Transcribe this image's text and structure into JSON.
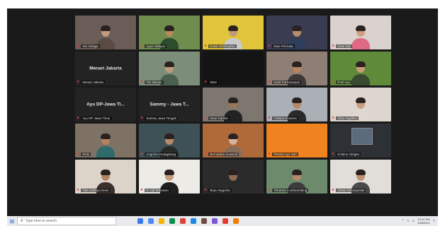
{
  "gallery": {
    "tiles": [
      {
        "label": "Vivi Sinaga",
        "bg": "#6a5d58",
        "kind": "video",
        "skin": "#c59a7c",
        "shirt": "#5a4a44"
      },
      {
        "label": "Agus Hidayat",
        "bg": "#6f8d4d",
        "kind": "video",
        "skin": "#b7885e",
        "shirt": "#2b4c2d",
        "active": true
      },
      {
        "label": "Erwin Christopher",
        "bg": "#e0c43a",
        "kind": "video",
        "skin": "#c59a7c",
        "shirt": "#c9c9c9"
      },
      {
        "label": "Dian Permata",
        "bg": "#3a3c52",
        "kind": "video",
        "skin": "#b58d6d",
        "shirt": "#2d3d5a"
      },
      {
        "label": "Dewi Sari",
        "bg": "#d9d2ce",
        "kind": "video",
        "skin": "#d0a080",
        "shirt": "#e06a86"
      },
      {
        "label": "Menari Jakarta",
        "bg": "#232323",
        "kind": "name",
        "center": "Menari Jakarta"
      },
      {
        "label": "Tim Menari",
        "bg": "#7c8e7a",
        "kind": "video",
        "skin": "#c29a7c",
        "shirt": "#4a6050"
      },
      {
        "label": "Wiwi",
        "bg": "#141414",
        "kind": "dark"
      },
      {
        "label": "Santi Purnamasari",
        "bg": "#8f7e74",
        "kind": "video",
        "skin": "#b8865e",
        "shirt": "#3e3a38"
      },
      {
        "label": "Putri Ayu",
        "bg": "#5e8a3a",
        "kind": "video",
        "skin": "#c99a78",
        "shirt": "#3a4a2e"
      },
      {
        "label": "Ayu DP Jawa Timur",
        "bg": "#232323",
        "kind": "name",
        "center": "Ayu DP-Jawa Ti..."
      },
      {
        "label": "Sammy Jawa Tengah",
        "bg": "#232323",
        "kind": "name",
        "center": "Sammy - Jawa T..."
      },
      {
        "label": "Irene Kartika",
        "bg": "#7d776f",
        "kind": "video",
        "skin": "#9d7658",
        "shirt": "#222222"
      },
      {
        "label": "Yuliana Kusuma",
        "bg": "#aab0b6",
        "kind": "video",
        "skin": "#b58866",
        "shirt": "#2a2a2a"
      },
      {
        "label": "Nina Angelina",
        "bg": "#dcd6cf",
        "kind": "video",
        "skin": "#c99e7d",
        "shirt": "#e0d8cf"
      },
      {
        "label": "Rizki",
        "bg": "#7e7265",
        "kind": "video",
        "skin": "#b4845e",
        "shirt": "#2f6b6a"
      },
      {
        "label": "Angelina Hutagalung",
        "bg": "#3e5157",
        "kind": "video",
        "skin": "#b98a66",
        "shirt": "#2a2a2a"
      },
      {
        "label": "Bernadeta Suwandi",
        "bg": "#b06a3a",
        "kind": "video",
        "skin": "#d7b09a",
        "shirt": "#8a6c5a"
      },
      {
        "label": "Teresia Ayu Sari",
        "bg": "#f0831f",
        "kind": "orange"
      },
      {
        "label": "Kristina Tarigan",
        "bg": "#2d3135",
        "kind": "screen"
      },
      {
        "label": "Tata Sulistya Dewi",
        "bg": "#dcd3c9",
        "kind": "video",
        "skin": "#b08560",
        "shirt": "#3a2f2c"
      },
      {
        "label": "R. Adi Setiawan",
        "bg": "#ecebe6",
        "kind": "video",
        "skin": "#c49b7b",
        "shirt": "#1f1f1f"
      },
      {
        "label": "Bayu Nugroho",
        "bg": "#2b2b2b",
        "kind": "video",
        "skin": "#8f6b52",
        "shirt": "#2b2b2b"
      },
      {
        "label": "Yohanes Lumbantobing",
        "bg": "#6e8a6c",
        "kind": "video",
        "skin": "#b28a6a",
        "shirt": "#3c3c3c"
      },
      {
        "label": "Johan Simanjuntak",
        "bg": "#e1ddd8",
        "kind": "video",
        "skin": "#c09070",
        "shirt": "#4a4a4a"
      }
    ]
  },
  "taskbar": {
    "search_placeholder": "Type here to search",
    "time": "10:12 PM",
    "date": "10/8/2021",
    "app_colors": [
      "#3b78e7",
      "#4c8bf5",
      "#f4b400",
      "#0a8f4e",
      "#db4437",
      "#1e88e5",
      "#6d4c41",
      "#7f56d9",
      "#e53935",
      "#f57c00"
    ]
  }
}
